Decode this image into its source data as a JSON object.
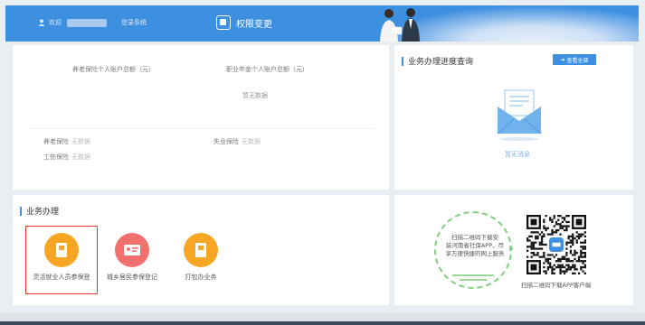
{
  "header": {
    "welcome": "欢迎",
    "login_link": "登录系统",
    "title": "权限变更"
  },
  "account": {
    "pension_total_label": "养老保险个人账户总额（元）",
    "annuity_total_label": "职业年金个人账户总额（元）",
    "no_data": "暂无数据",
    "items": [
      {
        "label": "养老保险",
        "value": "无数据"
      },
      {
        "label": "失业保险",
        "value": "无数据"
      },
      {
        "label": "工伤保险",
        "value": "无数据"
      }
    ]
  },
  "progress": {
    "title": "业务办理进度查询",
    "view_all": "查看全部",
    "empty": "暂无消息"
  },
  "business": {
    "title": "业务办理",
    "services": [
      {
        "label": "灵活就业人员参保登",
        "color": "#f6a623",
        "icon": "document-icon"
      },
      {
        "label": "城乡居民参保登记",
        "color": "#f2706d",
        "icon": "id-card-icon"
      },
      {
        "label": "打包办业务",
        "color": "#f6a623",
        "icon": "document-icon"
      }
    ]
  },
  "app": {
    "promo_lines": [
      "扫描二维码下载安",
      "装河南省社保APP，尽",
      "享方便快捷的网上服务"
    ],
    "caption": "扫描二维码下载APP客户端"
  },
  "colors": {
    "primary": "#3d8fe0",
    "orange": "#f6a623",
    "coral": "#f2706d",
    "highlight": "#e53935",
    "green": "#7ed07e"
  }
}
